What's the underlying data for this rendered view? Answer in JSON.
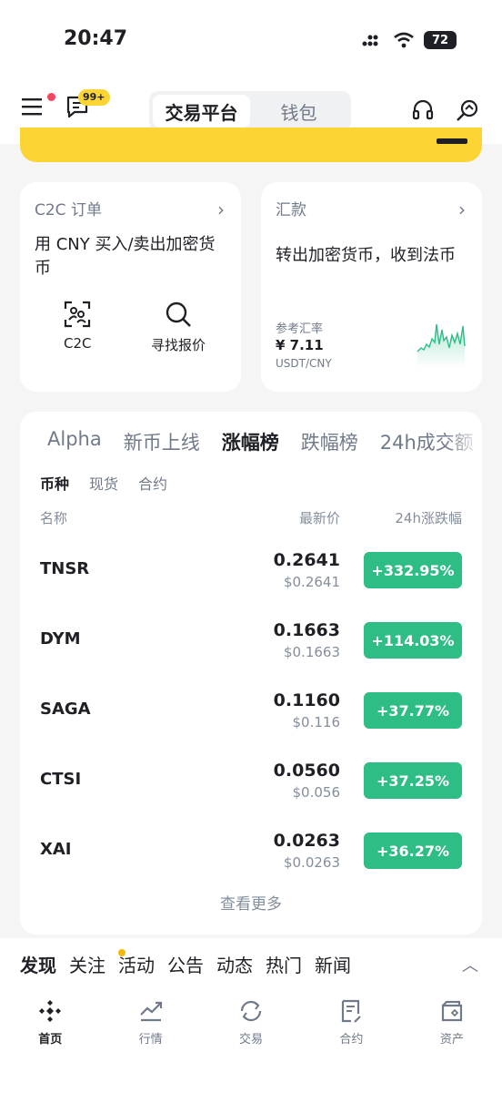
{
  "status": {
    "time": "20:47",
    "battery": "72"
  },
  "header": {
    "notif_badge": "99+",
    "tabs": [
      {
        "label": "交易平台",
        "active": true
      },
      {
        "label": "钱包",
        "active": false
      }
    ],
    "icons": [
      "menu-icon",
      "message-icon",
      "headset-icon",
      "search-quote-icon"
    ]
  },
  "c2c_card": {
    "title": "C2C 订单",
    "desc": "用 CNY 买入/卖出加密货币",
    "actions": [
      {
        "label": "C2C",
        "icon": "c2c-icon"
      },
      {
        "label": "寻找报价",
        "icon": "search-icon"
      }
    ]
  },
  "remit_card": {
    "title": "汇款",
    "desc": "转出加密货币，收到法币",
    "rate_label": "参考汇率",
    "rate_value": "¥ 7.11",
    "rate_pair": "USDT/CNY"
  },
  "market": {
    "tabs": [
      {
        "label": "Alpha",
        "active": false
      },
      {
        "label": "新币上线",
        "active": false
      },
      {
        "label": "涨幅榜",
        "active": true
      },
      {
        "label": "跌幅榜",
        "active": false
      },
      {
        "label": "24h成交额",
        "active": false
      }
    ],
    "sub_tabs": [
      {
        "label": "币种",
        "active": true
      },
      {
        "label": "现货",
        "active": false
      },
      {
        "label": "合约",
        "active": false
      }
    ],
    "columns": {
      "name": "名称",
      "price": "最新价",
      "change": "24h涨跌幅"
    },
    "rows": [
      {
        "symbol": "TNSR",
        "price": "0.2641",
        "fiat": "$0.2641",
        "change": "+332.95%"
      },
      {
        "symbol": "DYM",
        "price": "0.1663",
        "fiat": "$0.1663",
        "change": "+114.03%"
      },
      {
        "symbol": "SAGA",
        "price": "0.1160",
        "fiat": "$0.116",
        "change": "+37.77%"
      },
      {
        "symbol": "CTSI",
        "price": "0.0560",
        "fiat": "$0.056",
        "change": "+37.25%"
      },
      {
        "symbol": "XAI",
        "price": "0.0263",
        "fiat": "$0.0263",
        "change": "+36.27%"
      }
    ],
    "more": "查看更多",
    "up_color": "#2ebd85"
  },
  "discover_tabs": [
    {
      "label": "发现",
      "active": true
    },
    {
      "label": "关注",
      "active": false
    },
    {
      "label": "活动",
      "active": false
    },
    {
      "label": "公告",
      "active": false
    },
    {
      "label": "动态",
      "active": false
    },
    {
      "label": "热门",
      "active": false
    },
    {
      "label": "新闻",
      "active": false
    }
  ],
  "nav": [
    {
      "label": "首页",
      "icon": "home-icon",
      "active": true
    },
    {
      "label": "行情",
      "icon": "markets-icon",
      "active": false
    },
    {
      "label": "交易",
      "icon": "trade-icon",
      "active": false
    },
    {
      "label": "合约",
      "icon": "futures-icon",
      "active": false
    },
    {
      "label": "资产",
      "icon": "wallet-icon",
      "active": false
    }
  ],
  "colors": {
    "brand_yellow": "#fcd535",
    "up_green": "#2ebd85",
    "badge_red": "#f6465d"
  }
}
